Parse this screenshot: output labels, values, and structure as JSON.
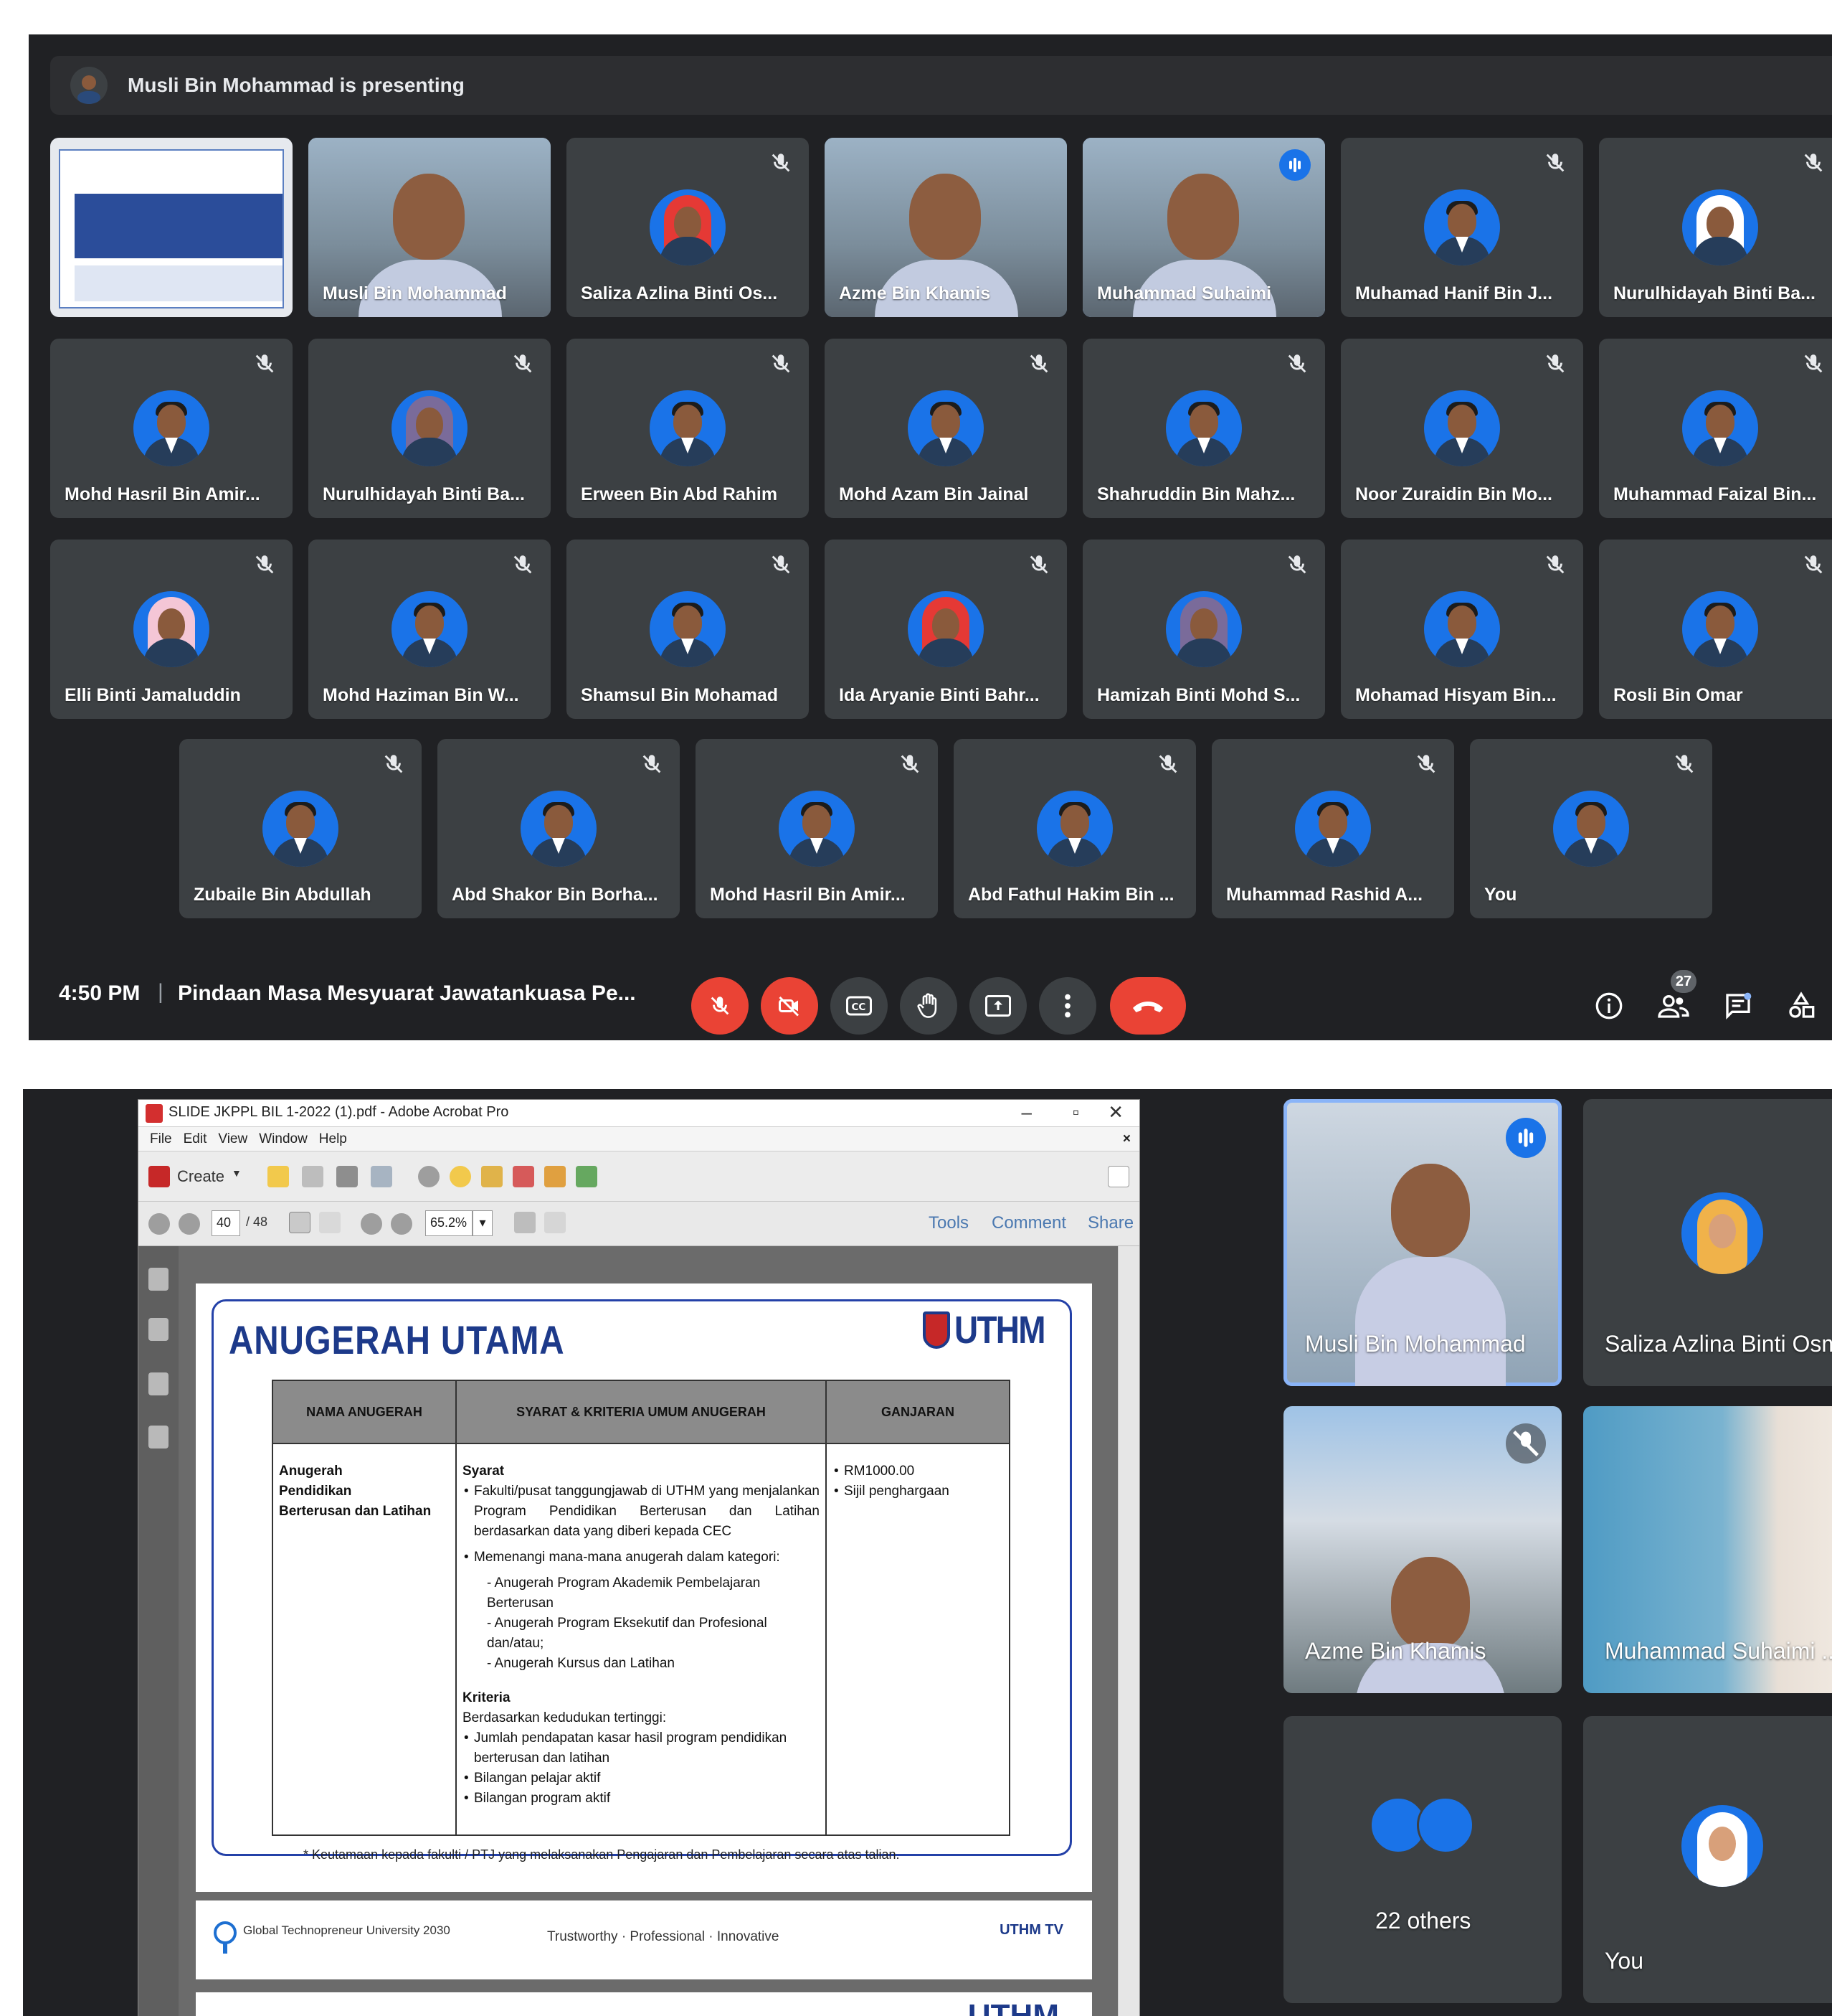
{
  "top_screen": {
    "presenting_banner": "Musli Bin Mohammad is presenting",
    "tiles": [
      {
        "name": "",
        "kind": "screen-share"
      },
      {
        "name": "Musli Bin Mohammad",
        "kind": "video"
      },
      {
        "name": "Saliza Azlina Binti Os...",
        "kind": "avatar",
        "muted": true,
        "hijab": true
      },
      {
        "name": "Azme Bin Khamis",
        "kind": "video"
      },
      {
        "name": "Muhammad Suhaimi",
        "kind": "video",
        "speaking": true
      },
      {
        "name": "Muhamad Hanif Bin J...",
        "kind": "avatar",
        "muted": true
      },
      {
        "name": "Nurulhidayah Binti Ba...",
        "kind": "avatar",
        "muted": true,
        "hijab": true
      },
      {
        "name": "Mohd Hasril Bin Amir...",
        "kind": "avatar",
        "muted": true
      },
      {
        "name": "Nurulhidayah Binti Ba...",
        "kind": "avatar",
        "muted": true,
        "hijab": true
      },
      {
        "name": "Erween Bin Abd Rahim",
        "kind": "avatar",
        "muted": true
      },
      {
        "name": "Mohd Azam Bin Jainal",
        "kind": "avatar",
        "muted": true
      },
      {
        "name": "Shahruddin Bin Mahz...",
        "kind": "avatar",
        "muted": true
      },
      {
        "name": "Noor Zuraidin Bin Mo...",
        "kind": "avatar",
        "muted": true
      },
      {
        "name": "Muhammad Faizal Bin...",
        "kind": "avatar",
        "muted": true
      },
      {
        "name": "Elli Binti Jamaluddin",
        "kind": "avatar",
        "muted": true,
        "hijab": true
      },
      {
        "name": "Mohd Haziman Bin W...",
        "kind": "avatar",
        "muted": true
      },
      {
        "name": "Shamsul Bin Mohamad",
        "kind": "avatar",
        "muted": true
      },
      {
        "name": "Ida Aryanie Binti Bahr...",
        "kind": "avatar",
        "muted": true,
        "hijab": true
      },
      {
        "name": "Hamizah Binti Mohd S...",
        "kind": "avatar",
        "muted": true,
        "hijab": true
      },
      {
        "name": "Mohamad Hisyam Bin...",
        "kind": "avatar",
        "muted": true
      },
      {
        "name": "Rosli Bin Omar",
        "kind": "avatar",
        "muted": true
      },
      {
        "name": "Zubaile Bin Abdullah",
        "kind": "avatar",
        "muted": true
      },
      {
        "name": "Abd Shakor Bin Borha...",
        "kind": "avatar",
        "muted": true
      },
      {
        "name": "Mohd Hasril Bin Amir...",
        "kind": "avatar",
        "muted": true
      },
      {
        "name": "Abd Fathul Hakim Bin ...",
        "kind": "avatar",
        "muted": true
      },
      {
        "name": "Muhammad Rashid A...",
        "kind": "avatar",
        "muted": true
      },
      {
        "name": "You",
        "kind": "avatar",
        "muted": true
      }
    ],
    "time": "4:50 PM",
    "separator": "|",
    "meeting_title": "Pindaan Masa Mesyuarat Jawatankuasa Pe...",
    "people_count": "27",
    "colors": {
      "bg": "#202124",
      "tile": "#3c4043",
      "red": "#ea4335",
      "accent": "#8ab4f8"
    }
  },
  "bottom_screen": {
    "acrobat": {
      "window_title": "SLIDE JKPPL BIL 1-2022 (1).pdf - Adobe Acrobat Pro",
      "menu": [
        "File",
        "Edit",
        "View",
        "Window",
        "Help"
      ],
      "create_label": "Create",
      "page_current": "40",
      "page_total": "/ 48",
      "zoom": "65.2%",
      "tools_label": "Tools",
      "comment_label": "Comment",
      "share_label": "Share"
    },
    "slide": {
      "title": "ANUGERAH UTAMA",
      "logo_text": "UTHM",
      "headers": [
        "NAMA ANUGERAH",
        "SYARAT & KRITERIA UMUM ANUGERAH",
        "GANJARAN"
      ],
      "award_name_lines": [
        "Anugerah",
        "Pendidikan",
        "Berterusan dan Latihan"
      ],
      "syarat_label": "Syarat",
      "syarat_items": [
        "Fakulti/pusat tanggungjawab di UTHM yang menjalankan Program Pendidikan Berterusan dan Latihan berdasarkan data yang diberi kepada CEC",
        "Memenangi mana-mana anugerah dalam kategori:"
      ],
      "kategori_items": [
        "- Anugerah Program Akademik Pembelajaran Berterusan",
        "- Anugerah Program Eksekutif dan Profesional dan/atau;",
        "- Anugerah Kursus dan Latihan"
      ],
      "kriteria_label": "Kriteria",
      "kriteria_intro": "Berdasarkan kedudukan tertinggi:",
      "kriteria_items": [
        "Jumlah pendapatan kasar hasil program pendidikan berterusan dan latihan",
        "Bilangan pelajar aktif",
        "Bilangan program aktif"
      ],
      "ganjaran_items": [
        "RM1000.00",
        "Sijil penghargaan"
      ],
      "footnote": "* Keutamaan kepada fakulti / PTJ yang melaksanakan Pengajaran dan Pembelajaran secara atas talian.",
      "footer_left": "Global Technopreneur University 2030",
      "footer_center": "Trustworthy · Professional · Innovative",
      "footer_right": "UTHM TV",
      "next_slide_logo": "UTHM"
    },
    "tiles": [
      {
        "name": "Musli Bin Mohammad",
        "kind": "video",
        "speaking": true
      },
      {
        "name": "Saliza Azlina Binti Osm...",
        "kind": "avatar",
        "hijab": true
      },
      {
        "name": "Azme Bin Khamis",
        "kind": "video"
      },
      {
        "name": "Muhammad Suhaimi ...",
        "kind": "video"
      },
      {
        "name": "22 others",
        "kind": "group"
      },
      {
        "name": "You",
        "kind": "avatar",
        "hijab": true
      }
    ]
  }
}
